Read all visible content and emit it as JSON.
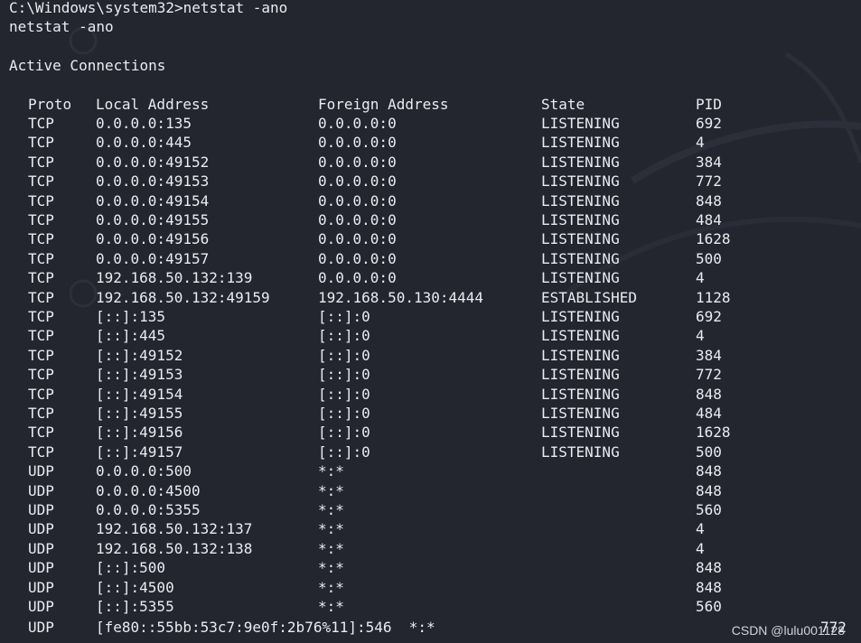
{
  "terminal": {
    "prompt_line": "C:\\Windows\\system32>netstat -ano",
    "echo_line": "netstat -ano",
    "section_title": "Active Connections",
    "headers": {
      "proto": "Proto",
      "local": "Local Address",
      "foreign": "Foreign Address",
      "state": "State",
      "pid": "PID"
    },
    "rows": [
      {
        "proto": "TCP",
        "local": "0.0.0.0:135",
        "foreign": "0.0.0.0:0",
        "state": "LISTENING",
        "pid": "692"
      },
      {
        "proto": "TCP",
        "local": "0.0.0.0:445",
        "foreign": "0.0.0.0:0",
        "state": "LISTENING",
        "pid": "4"
      },
      {
        "proto": "TCP",
        "local": "0.0.0.0:49152",
        "foreign": "0.0.0.0:0",
        "state": "LISTENING",
        "pid": "384"
      },
      {
        "proto": "TCP",
        "local": "0.0.0.0:49153",
        "foreign": "0.0.0.0:0",
        "state": "LISTENING",
        "pid": "772"
      },
      {
        "proto": "TCP",
        "local": "0.0.0.0:49154",
        "foreign": "0.0.0.0:0",
        "state": "LISTENING",
        "pid": "848"
      },
      {
        "proto": "TCP",
        "local": "0.0.0.0:49155",
        "foreign": "0.0.0.0:0",
        "state": "LISTENING",
        "pid": "484"
      },
      {
        "proto": "TCP",
        "local": "0.0.0.0:49156",
        "foreign": "0.0.0.0:0",
        "state": "LISTENING",
        "pid": "1628"
      },
      {
        "proto": "TCP",
        "local": "0.0.0.0:49157",
        "foreign": "0.0.0.0:0",
        "state": "LISTENING",
        "pid": "500"
      },
      {
        "proto": "TCP",
        "local": "192.168.50.132:139",
        "foreign": "0.0.0.0:0",
        "state": "LISTENING",
        "pid": "4"
      },
      {
        "proto": "TCP",
        "local": "192.168.50.132:49159",
        "foreign": "192.168.50.130:4444",
        "state": "ESTABLISHED",
        "pid": "1128"
      },
      {
        "proto": "TCP",
        "local": "[::]:135",
        "foreign": "[::]:0",
        "state": "LISTENING",
        "pid": "692"
      },
      {
        "proto": "TCP",
        "local": "[::]:445",
        "foreign": "[::]:0",
        "state": "LISTENING",
        "pid": "4"
      },
      {
        "proto": "TCP",
        "local": "[::]:49152",
        "foreign": "[::]:0",
        "state": "LISTENING",
        "pid": "384"
      },
      {
        "proto": "TCP",
        "local": "[::]:49153",
        "foreign": "[::]:0",
        "state": "LISTENING",
        "pid": "772"
      },
      {
        "proto": "TCP",
        "local": "[::]:49154",
        "foreign": "[::]:0",
        "state": "LISTENING",
        "pid": "848"
      },
      {
        "proto": "TCP",
        "local": "[::]:49155",
        "foreign": "[::]:0",
        "state": "LISTENING",
        "pid": "484"
      },
      {
        "proto": "TCP",
        "local": "[::]:49156",
        "foreign": "[::]:0",
        "state": "LISTENING",
        "pid": "1628"
      },
      {
        "proto": "TCP",
        "local": "[::]:49157",
        "foreign": "[::]:0",
        "state": "LISTENING",
        "pid": "500"
      },
      {
        "proto": "UDP",
        "local": "0.0.0.0:500",
        "foreign": "*:*",
        "state": "",
        "pid": "848"
      },
      {
        "proto": "UDP",
        "local": "0.0.0.0:4500",
        "foreign": "*:*",
        "state": "",
        "pid": "848"
      },
      {
        "proto": "UDP",
        "local": "0.0.0.0:5355",
        "foreign": "*:*",
        "state": "",
        "pid": "560"
      },
      {
        "proto": "UDP",
        "local": "192.168.50.132:137",
        "foreign": "*:*",
        "state": "",
        "pid": "4"
      },
      {
        "proto": "UDP",
        "local": "192.168.50.132:138",
        "foreign": "*:*",
        "state": "",
        "pid": "4"
      },
      {
        "proto": "UDP",
        "local": "[::]:500",
        "foreign": "*:*",
        "state": "",
        "pid": "848"
      },
      {
        "proto": "UDP",
        "local": "[::]:4500",
        "foreign": "*:*",
        "state": "",
        "pid": "848"
      },
      {
        "proto": "UDP",
        "local": "[::]:5355",
        "foreign": "*:*",
        "state": "",
        "pid": "560"
      }
    ],
    "last_row": {
      "proto": "UDP",
      "text": "[fe80::55bb:53c7:9e0f:2b76%11]:546  *:*",
      "pid": "772"
    }
  },
  "watermark": "CSDN @lulu001128",
  "colors": {
    "background": "#23252f",
    "text": "#e9ecf2"
  }
}
